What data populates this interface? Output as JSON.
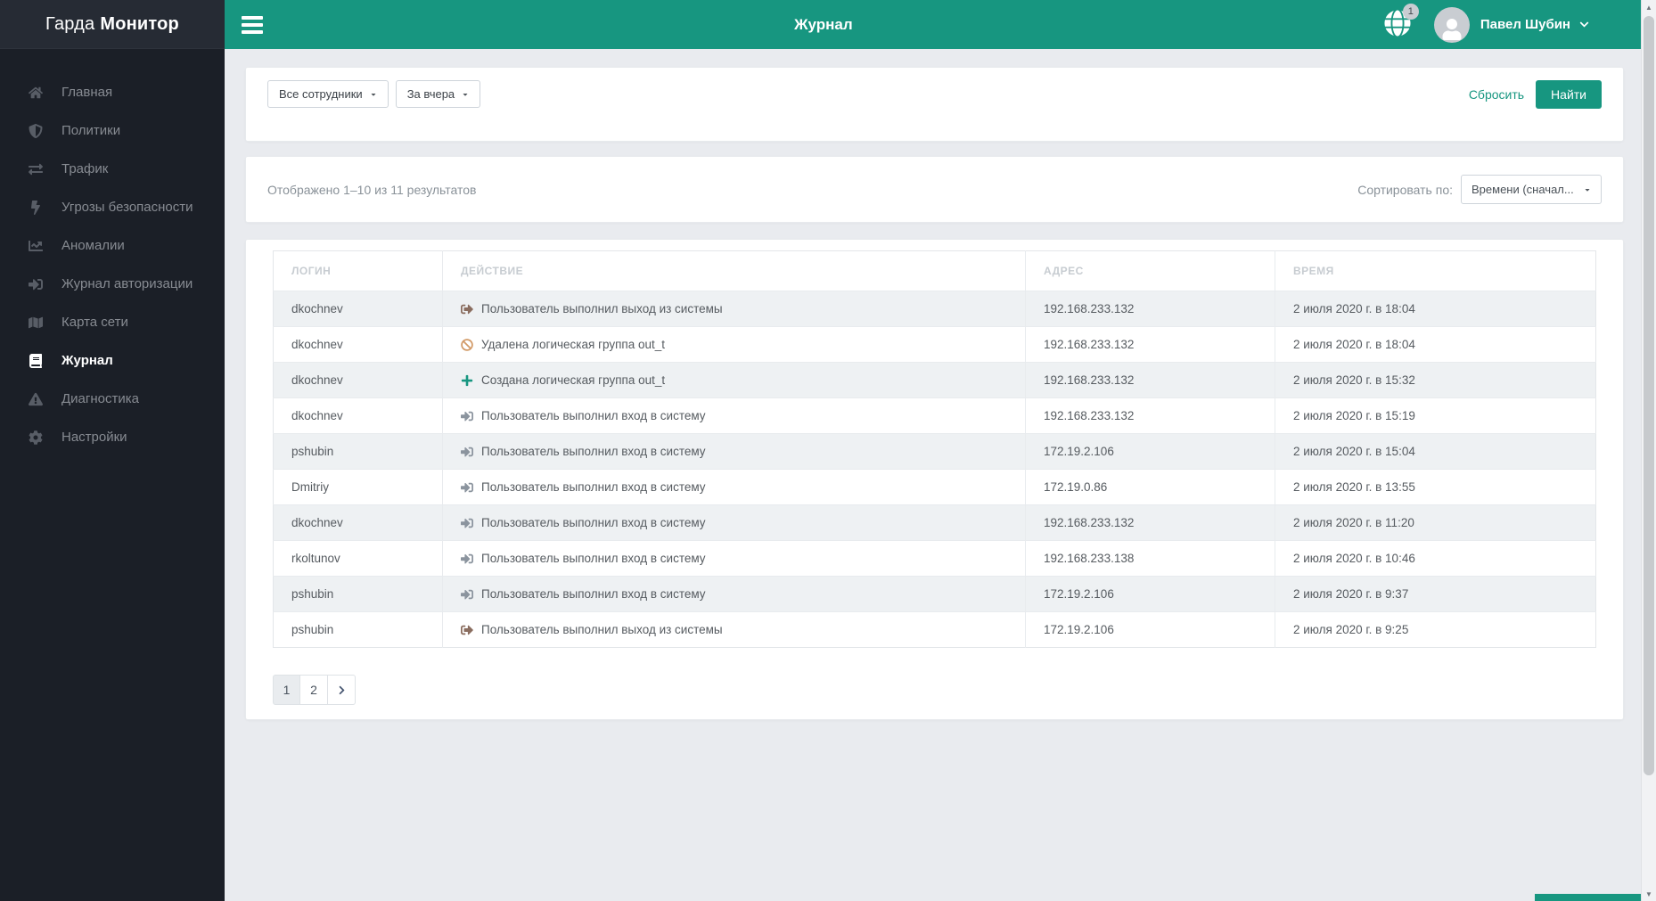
{
  "brand": {
    "regular": "Гарда",
    "bold": "Монитор"
  },
  "header": {
    "title": "Журнал",
    "notification_count": "1",
    "user_name": "Павел Шубин",
    "globe_icon": "globe-icon",
    "user_icon": "user-icon"
  },
  "sidebar": {
    "items": [
      {
        "icon": "home-icon",
        "label": "Главная",
        "active": false
      },
      {
        "icon": "shield-icon",
        "label": "Политики",
        "active": false
      },
      {
        "icon": "exchange-icon",
        "label": "Трафик",
        "active": false
      },
      {
        "icon": "bolt-icon",
        "label": "Угрозы безопасности",
        "active": false
      },
      {
        "icon": "chart-line-icon",
        "label": "Аномалии",
        "active": false
      },
      {
        "icon": "sign-in-icon",
        "label": "Журнал авторизации",
        "active": false
      },
      {
        "icon": "map-icon",
        "label": "Карта сети",
        "active": false
      },
      {
        "icon": "book-icon",
        "label": "Журнал",
        "active": true
      },
      {
        "icon": "warning-triangle-icon",
        "label": "Диагностика",
        "active": false
      },
      {
        "icon": "gear-icon",
        "label": "Настройки",
        "active": false
      }
    ]
  },
  "filters": {
    "employee_filter": "Все сотрудники",
    "period_filter": "За вчера",
    "reset_label": "Сбросить",
    "search_label": "Найти"
  },
  "results": {
    "summary": "Отображено 1–10 из 11 результатов",
    "sort_label": "Сортировать по:",
    "sort_value": "Времени (сначал..."
  },
  "table": {
    "columns": [
      "ЛОГИН",
      "ДЕЙСТВИЕ",
      "АДРЕС",
      "ВРЕМЯ"
    ],
    "rows": [
      {
        "login": "dkochnev",
        "action_icon": "sign-out-icon",
        "action": "Пользователь выполнил выход из системы",
        "address": "192.168.233.132",
        "time": "2 июля 2020 г. в 18:04"
      },
      {
        "login": "dkochnev",
        "action_icon": "ban-icon",
        "action": "Удалена логическая группа out_t",
        "address": "192.168.233.132",
        "time": "2 июля 2020 г. в 18:04"
      },
      {
        "login": "dkochnev",
        "action_icon": "plus-icon",
        "action": "Создана логическая группа out_t",
        "address": "192.168.233.132",
        "time": "2 июля 2020 г. в 15:32"
      },
      {
        "login": "dkochnev",
        "action_icon": "sign-in-icon",
        "action": "Пользователь выполнил вход в систему",
        "address": "192.168.233.132",
        "time": "2 июля 2020 г. в 15:19"
      },
      {
        "login": "pshubin",
        "action_icon": "sign-in-icon",
        "action": "Пользователь выполнил вход в систему",
        "address": "172.19.2.106",
        "time": "2 июля 2020 г. в 15:04"
      },
      {
        "login": "Dmitriy",
        "action_icon": "sign-in-icon",
        "action": "Пользователь выполнил вход в систему",
        "address": "172.19.0.86",
        "time": "2 июля 2020 г. в 13:55"
      },
      {
        "login": "dkochnev",
        "action_icon": "sign-in-icon",
        "action": "Пользователь выполнил вход в систему",
        "address": "192.168.233.132",
        "time": "2 июля 2020 г. в 11:20"
      },
      {
        "login": "rkoltunov",
        "action_icon": "sign-in-icon",
        "action": "Пользователь выполнил вход в систему",
        "address": "192.168.233.138",
        "time": "2 июля 2020 г. в 10:46"
      },
      {
        "login": "pshubin",
        "action_icon": "sign-in-icon",
        "action": "Пользователь выполнил вход в систему",
        "address": "172.19.2.106",
        "time": "2 июля 2020 г. в 9:37"
      },
      {
        "login": "pshubin",
        "action_icon": "sign-out-icon",
        "action": "Пользователь выполнил выход из системы",
        "address": "172.19.2.106",
        "time": "2 июля 2020 г. в 9:25"
      }
    ]
  },
  "pagination": {
    "pages": [
      "1",
      "2"
    ],
    "active": "1",
    "next_icon": "chevron-right-icon"
  },
  "colors": {
    "accent": "#179680",
    "sidebar_bg": "#1b1f27",
    "content_bg": "#e9ebef",
    "action_icons": {
      "sign-out-icon": "#8a6d5f",
      "ban-icon": "#d29a67",
      "plus-icon": "#179680",
      "sign-in-icon": "#8b949e"
    }
  }
}
